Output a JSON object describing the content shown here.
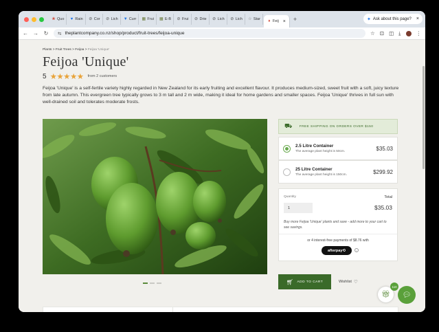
{
  "browser": {
    "tabs": [
      {
        "label": "Quo",
        "color": "#d14b3a",
        "glyph": "❀"
      },
      {
        "label": "Rain",
        "color": "#1a73e8",
        "glyph": "♥"
      },
      {
        "label": "Cor",
        "color": "#555555",
        "glyph": "⊘"
      },
      {
        "label": "Lich",
        "color": "#555555",
        "glyph": "⊘"
      },
      {
        "label": "Curr",
        "color": "#1a73e8",
        "glyph": "▼"
      },
      {
        "label": "Frui",
        "color": "#6a7a3a",
        "glyph": "▦"
      },
      {
        "label": "E-B",
        "color": "#6a7a3a",
        "glyph": "▦"
      },
      {
        "label": "Frui",
        "color": "#555555",
        "glyph": "⊘"
      },
      {
        "label": "Drie",
        "color": "#555555",
        "glyph": "⊘"
      },
      {
        "label": "Lich",
        "color": "#555555",
        "glyph": "⊘"
      },
      {
        "label": "Lich",
        "color": "#555555",
        "glyph": "⊘"
      },
      {
        "label": "Star",
        "color": "#777777",
        "glyph": "☆"
      },
      {
        "label": "Feij",
        "color": "#d14b3a",
        "glyph": "♦"
      }
    ],
    "active_tab_close": "×",
    "new_tab": "+",
    "ask_label": "Ask about this page?",
    "window_close": "×",
    "url": "theplantcompany.co.nz/shop/product/fruit-trees/feijoa-unique"
  },
  "breadcrumb": {
    "items": [
      "Plants",
      "Fruit Trees",
      "Feijoa"
    ],
    "current": "Feijoa 'Unique'",
    "separator": ">"
  },
  "product": {
    "title": "Feijoa 'Unique'",
    "rating_value": "5",
    "stars": "★★★★★",
    "reviews": "from 2 customers",
    "description": "Feijoa 'Unique' is a self-fertile variety highly regarded in New Zealand for its early fruiting and excellent flavour. It produces medium-sized, sweet fruit with a soft, juicy texture from late autumn. This evergreen tree typically grows to 3 m tall and 2 m wide, making it ideal for home gardens and smaller spaces. Feijoa 'Unique' thrives in full sun with well-drained soil and tolerates moderate frosts."
  },
  "shipping": {
    "text": "FREE SHIPPING ON ORDERS OVER $150"
  },
  "options": [
    {
      "title": "2.5 Litre Container",
      "sub": "The average plant height is 50cm.",
      "price": "$35.03",
      "selected": true
    },
    {
      "title": "25 Litre Container",
      "sub": "The average plant height is 150cm.",
      "price": "$299.92",
      "selected": false
    }
  ],
  "purchase": {
    "quantity_label": "Quantity",
    "quantity_value": "1",
    "total_label": "Total",
    "total_value": "$35.03",
    "promo": "Buy more Feijoa 'Unique' plants and save - add more to your cart to see savings.",
    "installments": "or 4 interest-free payments of $8.76 with",
    "afterpay": "afterpay⟲",
    "info": "i",
    "add_to_cart": "ADD TO CART",
    "wishlist": "Wishlist",
    "heart": "♡"
  },
  "widgets": {
    "badge": "110"
  }
}
